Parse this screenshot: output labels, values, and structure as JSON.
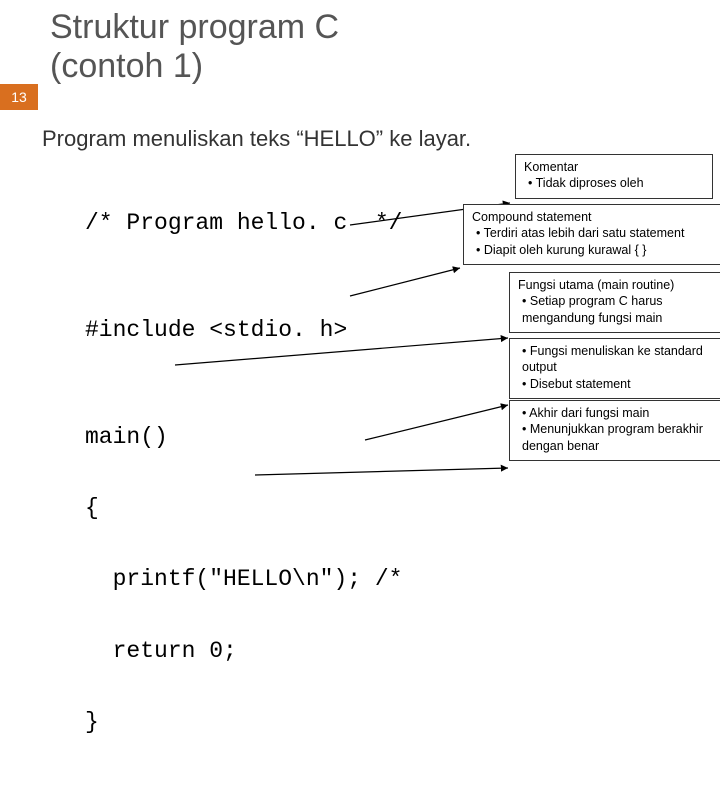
{
  "page_number": "13",
  "title_line1": "Struktur program C",
  "title_line2": "(contoh 1)",
  "subtitle": "Program menuliskan teks “HELLO” ke layar.",
  "code": {
    "l1": "/* Program hello. c  */",
    "l2": "",
    "l3": "#include <stdio. h>",
    "l4": "",
    "l5": "main()",
    "l6": "{",
    "l7": "  printf(\"HELLO\\n\"); /*",
    "l8": "  return 0;",
    "l9": "}"
  },
  "callouts": {
    "comment": {
      "title": "Komentar",
      "b1": "Tidak diproses  oleh"
    },
    "compound": {
      "title": "Compound statement",
      "b1": "Terdiri atas lebih dari satu statement",
      "b2": "Diapit oleh kurung kurawal { }"
    },
    "main": {
      "title": "Fungsi utama (main routine)",
      "b1": "Setiap program C harus mengandung fungsi main"
    },
    "printf": {
      "b1": "Fungsi menuliskan ke standard output",
      "b2": "Disebut statement"
    },
    "ret": {
      "b1": "Akhir dari fungsi main",
      "b2": "Menunjukkan program berakhir dengan benar"
    }
  }
}
